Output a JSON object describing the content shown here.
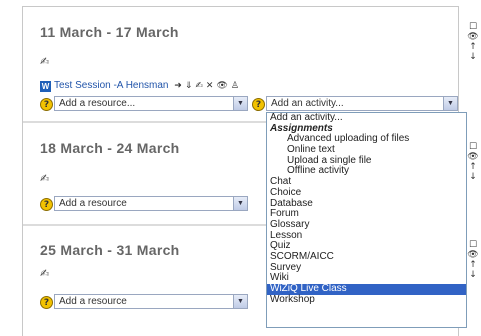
{
  "weeks": [
    {
      "title": "11 March - 17 March",
      "resource_placeholder": "Add a resource...",
      "activity_placeholder": "Add an activity..."
    },
    {
      "title": "18 March - 24 March",
      "resource_placeholder": "Add a resource"
    },
    {
      "title": "25 March - 31 March",
      "resource_placeholder": "Add a resource"
    }
  ],
  "activity_item": {
    "icon_letter": "W",
    "label": "Test Session -A Hensman"
  },
  "activity_controls": {
    "move": "➜",
    "indent": "⇓",
    "edit": "✍",
    "delete": "✕",
    "show": "👁",
    "assign": "♙"
  },
  "dropdown_options": [
    {
      "label": "Add an activity...",
      "kind": "normal"
    },
    {
      "label": "Assignments",
      "kind": "group"
    },
    {
      "label": "Advanced uploading of files",
      "kind": "indent"
    },
    {
      "label": "Online text",
      "kind": "indent"
    },
    {
      "label": "Upload a single file",
      "kind": "indent"
    },
    {
      "label": "Offline activity",
      "kind": "indent"
    },
    {
      "label": "Chat",
      "kind": "normal"
    },
    {
      "label": "Choice",
      "kind": "normal"
    },
    {
      "label": "Database",
      "kind": "normal"
    },
    {
      "label": "Forum",
      "kind": "normal"
    },
    {
      "label": "Glossary",
      "kind": "normal"
    },
    {
      "label": "Lesson",
      "kind": "normal"
    },
    {
      "label": "Quiz",
      "kind": "normal"
    },
    {
      "label": "SCORM/AICC",
      "kind": "normal"
    },
    {
      "label": "Survey",
      "kind": "normal"
    },
    {
      "label": "Wiki",
      "kind": "normal"
    },
    {
      "label": "WiZiQ Live Class",
      "kind": "selected"
    },
    {
      "label": "Workshop",
      "kind": "normal"
    }
  ],
  "help_symbol": "?",
  "dropdown_arrow": "▼",
  "edit_glyph": "✍",
  "side_icons": {
    "checkbox": "☐",
    "eye": "👁",
    "up": "↑",
    "down": "↓"
  },
  "colors": {
    "selected": "#3163c5",
    "link": "#2255aa",
    "help": "#f2c200"
  }
}
